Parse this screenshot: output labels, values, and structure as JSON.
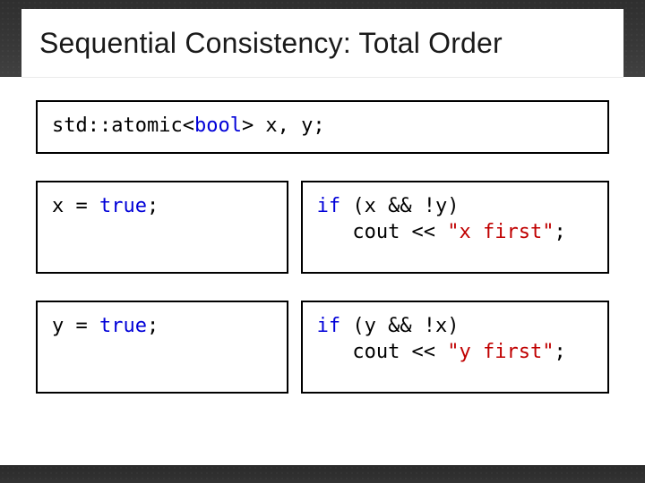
{
  "title": "Sequential Consistency: Total Order",
  "decl": {
    "prefix": "std::atomic<",
    "type": "bool",
    "suffix": "> x, y;"
  },
  "rows": [
    {
      "left_kw": "true",
      "left_prefix": "x = ",
      "left_suffix": ";",
      "right_kw": "if",
      "right_cond": " (x && !y)",
      "right_line2_prefix": "   cout << ",
      "right_str": "\"x first\"",
      "right_line2_suffix": ";"
    },
    {
      "left_kw": "true",
      "left_prefix": "y = ",
      "left_suffix": ";",
      "right_kw": "if",
      "right_cond": " (y && !x)",
      "right_line2_prefix": "   cout << ",
      "right_str": "\"y first\"",
      "right_line2_suffix": ";"
    }
  ]
}
